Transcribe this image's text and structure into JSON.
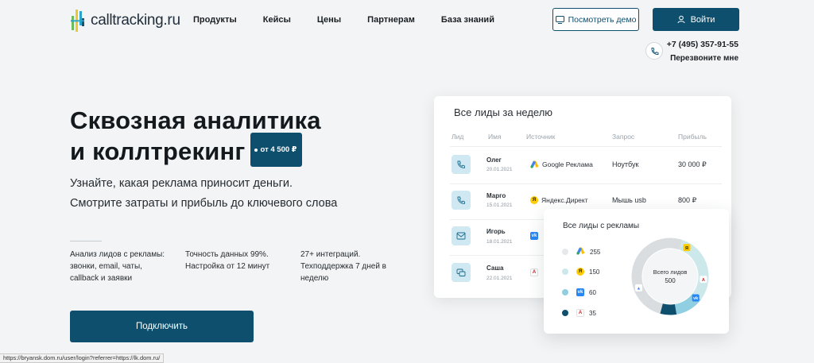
{
  "header": {
    "logo_text": "calltracking.ru",
    "nav": [
      "Продукты",
      "Кейсы",
      "Цены",
      "Партнерам",
      "База знаний"
    ],
    "demo_label": "Посмотреть демо",
    "login_label": "Войти",
    "phone": "+7 (495) 357-91-55",
    "callback": "Перезвоните мне"
  },
  "hero": {
    "title_line1": "Сквозная аналитика",
    "title_line2": "и коллтрекинг",
    "price_badge": "от 4 500 ₽",
    "subtitle_line1": "Узнайте, какая реклама приносит деньги.",
    "subtitle_line2": "Смотрите затраты и прибыль до ключевого слова",
    "features": [
      [
        "Анализ лидов с рекламы:",
        "звонки, email, чаты,",
        "callback и заявки"
      ],
      [
        "Точность данных 99%.",
        "Настройка от 12 минут"
      ],
      [
        "27+ интеграций.",
        "Техподдержка 7 дней в",
        "неделю"
      ]
    ],
    "connect_label": "Подключить"
  },
  "status_url": "https://bryansk.dom.ru/user/login?referrer=https://lk.dom.ru/",
  "leads_card": {
    "title": "Все лиды за неделю",
    "columns": [
      "Лид",
      "Имя",
      "Источник",
      "Запрос",
      "Прибыль"
    ],
    "rows": [
      {
        "type": "call-icon",
        "name": "Олег",
        "date": "20.01.2021",
        "source": "Google Реклама",
        "source_icon": "google-ads-icon",
        "query": "Ноутбук",
        "profit": "30 000 ₽"
      },
      {
        "type": "call-icon",
        "name": "Марго",
        "date": "15.01.2021",
        "source": "Яндекс.Директ",
        "source_icon": "yandex-direct-icon",
        "query": "Мышь usb",
        "profit": "800 ₽"
      },
      {
        "type": "email-icon",
        "name": "Игорь",
        "date": "18.01.2021",
        "source": "",
        "source_icon": "vk-icon",
        "query": "",
        "profit": ""
      },
      {
        "type": "chat-icon",
        "name": "Саша",
        "date": "22.01.2021",
        "source": "",
        "source_icon": "avito-icon",
        "query": "",
        "profit": ""
      }
    ]
  },
  "ads_card": {
    "title": "Все лиды с рекламы",
    "center_label": "Всего лидов",
    "center_value": "500",
    "colors": {
      "google": "#d9dde0",
      "yandex": "#cde8ea",
      "vk": "#8fcfe1",
      "avito": "#0e4f6e"
    },
    "legend": [
      {
        "icon": "google-ads-icon",
        "value": "255"
      },
      {
        "icon": "yandex-direct-icon",
        "value": "150"
      },
      {
        "icon": "vk-icon",
        "value": "60"
      },
      {
        "icon": "avito-icon",
        "value": "35"
      }
    ]
  }
}
